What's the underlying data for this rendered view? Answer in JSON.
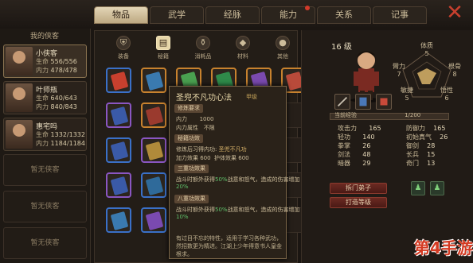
{
  "tabs": [
    {
      "label": "物品",
      "active": true
    },
    {
      "label": "武学",
      "active": false
    },
    {
      "label": "经脉",
      "active": false
    },
    {
      "label": "能力",
      "active": false,
      "dot": true
    },
    {
      "label": "关系",
      "active": false
    },
    {
      "label": "记事",
      "active": false
    }
  ],
  "party": {
    "title": "我的侠客",
    "members": [
      {
        "name": "小侠客",
        "hp_label": "生命",
        "hp": "556/556",
        "mp_label": "内力",
        "mp": "478/478"
      },
      {
        "name": "叶师瓶",
        "hp_label": "生命",
        "hp": "640/643",
        "mp_label": "内力",
        "mp": "840/843"
      },
      {
        "name": "惠宅吗",
        "hp_label": "生命",
        "hp": "1332/1332",
        "mp_label": "内力",
        "mp": "1184/1184"
      }
    ],
    "empty_label": "暂无侠客"
  },
  "categories": [
    {
      "label": "装备",
      "icon": "shield-icon"
    },
    {
      "label": "秘籍",
      "icon": "book-icon",
      "active": true
    },
    {
      "label": "消耗品",
      "icon": "potion-icon"
    },
    {
      "label": "材料",
      "icon": "ore-icon"
    },
    {
      "label": "其他",
      "icon": "pouch-icon"
    }
  ],
  "items": [
    {
      "color": "#3a70c8",
      "book": "#c8402e",
      "count": "",
      "row": 0,
      "col": 0
    },
    {
      "color": "#c8822e",
      "book": "#3a7ab0",
      "count": "",
      "row": 0,
      "col": 1
    },
    {
      "color": "#c8822e",
      "book": "#4aa050",
      "count": "",
      "row": 0,
      "col": 2
    },
    {
      "color": "#c8822e",
      "book": "#2f8a4a",
      "count": "",
      "row": 0,
      "col": 3
    },
    {
      "color": "#c8822e",
      "book": "#7a4ab0",
      "count": "",
      "row": 0,
      "col": 4
    },
    {
      "color": "#c8822e",
      "book": "#b84a3a",
      "count": "",
      "row": 0,
      "col": 5
    },
    {
      "color": "#8a56c2",
      "book": "#3a5aa8",
      "count": "",
      "row": 1,
      "col": 0
    },
    {
      "color": "#c8822e",
      "book": "#9a3a2e",
      "count": "",
      "row": 1,
      "col": 1
    },
    {
      "color": "#3a70c8",
      "book": "#3a5aa8",
      "count": "",
      "row": 2,
      "col": 0
    },
    {
      "color": "#8a56c2",
      "book": "#b08a3a",
      "count": "",
      "row": 2,
      "col": 1
    },
    {
      "color": "#8a56c2",
      "book": "#3a5aa8",
      "count": "",
      "row": 3,
      "col": 0
    },
    {
      "color": "#3a70c8",
      "book": "#2f6a9a",
      "count": "",
      "row": 3,
      "col": 1
    },
    {
      "color": "#3a70c8",
      "book": "#3a7ab0",
      "count": "",
      "row": 4,
      "col": 0
    },
    {
      "color": "#3a70c8",
      "book": "#7a4ab0",
      "count": "",
      "row": 4,
      "col": 1
    }
  ],
  "tooltip": {
    "title": "圣兜不凡功心法",
    "grade": "甲级",
    "sec1": "修炼要求",
    "req_label": "内力",
    "req_value": "1000",
    "attr_label": "内力属性",
    "attr_value": "不限",
    "sec2": "秘籍功效",
    "learn_label": "修炼后习得内功:",
    "learn_value": "圣兜不凡功",
    "bonus1": "加力效果 600",
    "bonus2": "护体效果 600",
    "sec3": "三重功效果",
    "effect1a": "战斗时额外获得",
    "effect1b": "50%",
    "effect1c": "战意和怒气，造成的伤害增加",
    "effect1d": "20%",
    "sec4": "八重功效果",
    "effect2a": "战斗时额外获得",
    "effect2b": "50%",
    "effect2c": "战意和怒气，造成的伤害增加",
    "effect2d": "10%",
    "desc": "有过目不忘的特性，适用于学习各种武功，然招数更为精进。江湖上少年得意书人皇金根求。"
  },
  "character": {
    "level": "16 级",
    "radar": {
      "top_label": "体质",
      "top_value": "5",
      "left_label": "臂力",
      "left_value": "7",
      "right_label": "根骨",
      "right_value": "8",
      "bl_label": "敏捷",
      "bl_value": "5",
      "br_label": "悟性",
      "br_value": "6"
    },
    "exp_label": "当前经验",
    "exp": "0",
    "exp_max": "1/200",
    "exp_fraction": 0.0,
    "stats_left": [
      {
        "label": "攻击力",
        "value": "165"
      },
      {
        "label": "轻功",
        "value": "140"
      },
      {
        "label": "拳掌",
        "value": "26"
      },
      {
        "label": "剑法",
        "value": "48"
      },
      {
        "label": "暗器",
        "value": "29"
      }
    ],
    "stats_right": [
      {
        "label": "防御力",
        "value": "165"
      },
      {
        "label": "初始真气",
        "value": "26"
      },
      {
        "label": "御剑",
        "value": "28"
      },
      {
        "label": "长兵",
        "value": "15"
      },
      {
        "label": "奇门",
        "value": "13"
      }
    ],
    "btn1": "拆门弟子",
    "btn2": "打造等级"
  },
  "watermark": "第4手游"
}
